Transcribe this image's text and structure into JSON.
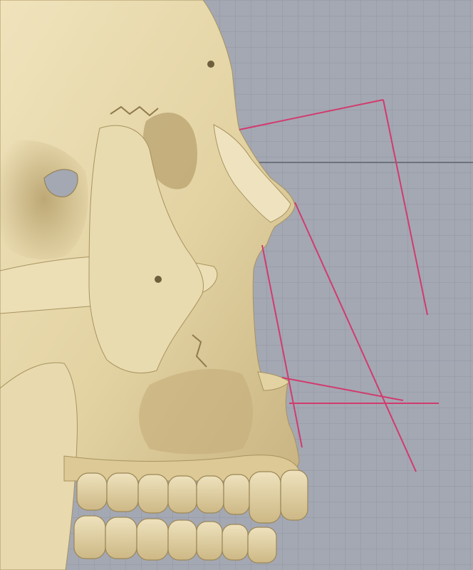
{
  "viewport": {
    "background_color": "#a4a8b3",
    "grid_line_color": "#9096a3",
    "horizon_line_color": "#6e727c",
    "grid": true
  },
  "model": {
    "subject": "skull-lateral-view",
    "bone_color": "#e3d3a3",
    "bone_shadow_color": "#bda775",
    "bone_highlight_color": "#f5ecd0"
  },
  "annotations": {
    "measurement_line_color": "#d13b6e",
    "line_count": 6
  }
}
